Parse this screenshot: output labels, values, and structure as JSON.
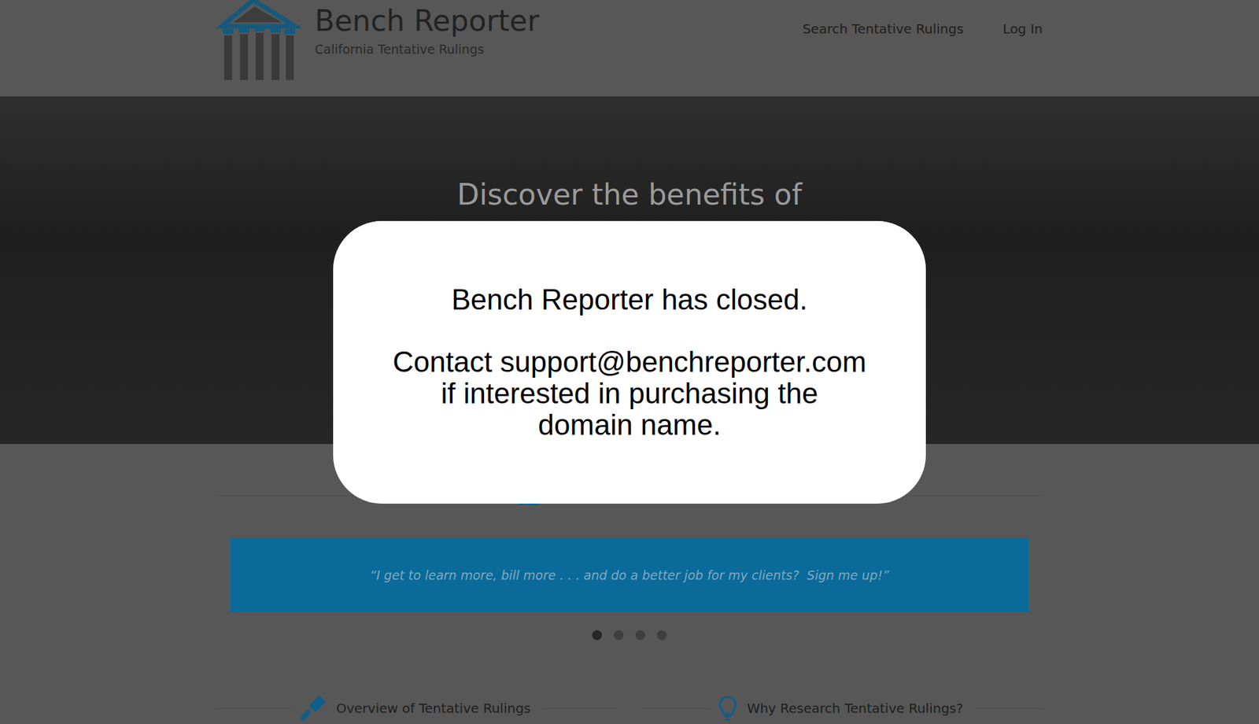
{
  "header": {
    "title": "Bench Reporter",
    "subtitle": "California Tentative Rulings",
    "nav": [
      "Search Tentative Rulings",
      "Log In"
    ]
  },
  "hero": {
    "heading": "Discover the benefits of"
  },
  "testimonial": {
    "quote": "“I get to learn more, bill more . . . and do a better job for my clients?  Sign me up!”"
  },
  "carousel_dots": [
    {
      "selected": true
    },
    {
      "selected": false
    },
    {
      "selected": false
    },
    {
      "selected": false
    }
  ],
  "features": [
    "Overview of Tentative Rulings",
    "Why Research Tentative Rulings?"
  ],
  "modal": {
    "title": "Bench Reporter has closed.",
    "message_lines": [
      "Contact support@benchreporter.com",
      "if interested in purchasing the",
      "domain name."
    ]
  }
}
